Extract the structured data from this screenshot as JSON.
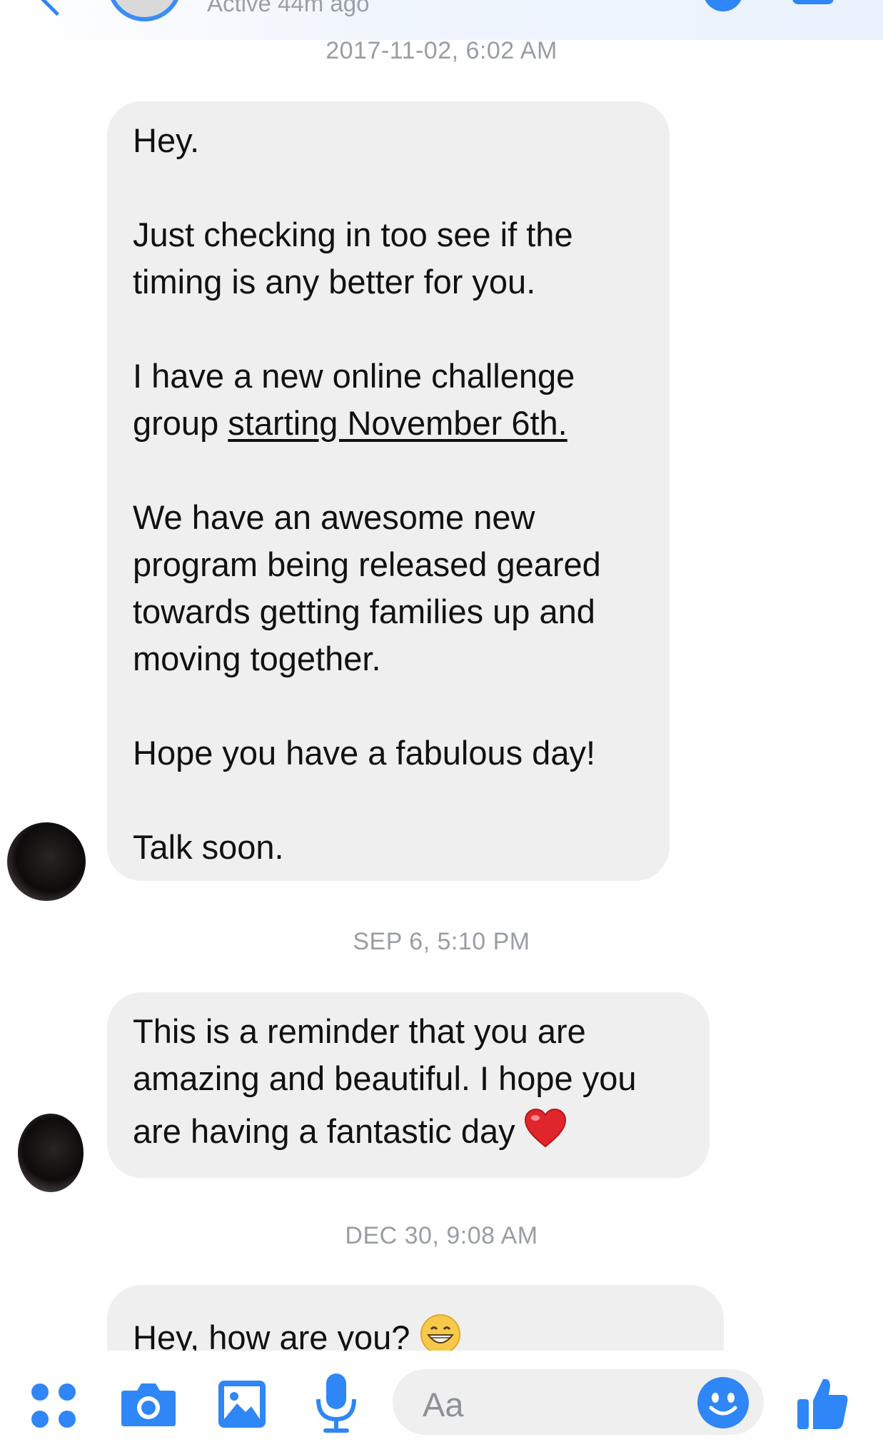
{
  "header": {
    "active_status": "Active 44m ago"
  },
  "thread": {
    "timestamps": [
      "2017-11-02, 6:02 AM",
      "SEP 6, 5:10 PM",
      "DEC 30, 9:08 AM"
    ],
    "message1": {
      "p1": "Hey.",
      "p2": "Just checking in too see if the timing is any better for you.",
      "p3_prefix": "I have a new online challenge group ",
      "p3_link": "starting November 6th.",
      "p4": "We have an awesome new program being released geared towards getting families up and moving together.",
      "p5": "Hope you have a fabulous day!",
      "p6": "Talk soon."
    },
    "message2": {
      "line1": "This is a reminder that you are",
      "line2": "amazing and beautiful. I hope you",
      "line3": "are having a fantastic day",
      "emoji": "red-heart"
    },
    "message3": {
      "text": "Hey,  how are you?",
      "emoji": "grinning-face"
    }
  },
  "composer": {
    "placeholder": "Aa"
  },
  "colors": {
    "accent": "#2f86f6",
    "bubble": "#efefef",
    "timestamp": "#9a9ea3"
  },
  "icons": [
    "more-apps-icon",
    "camera-icon",
    "gallery-icon",
    "microphone-icon",
    "emoji-icon",
    "thumbs-up-icon"
  ]
}
